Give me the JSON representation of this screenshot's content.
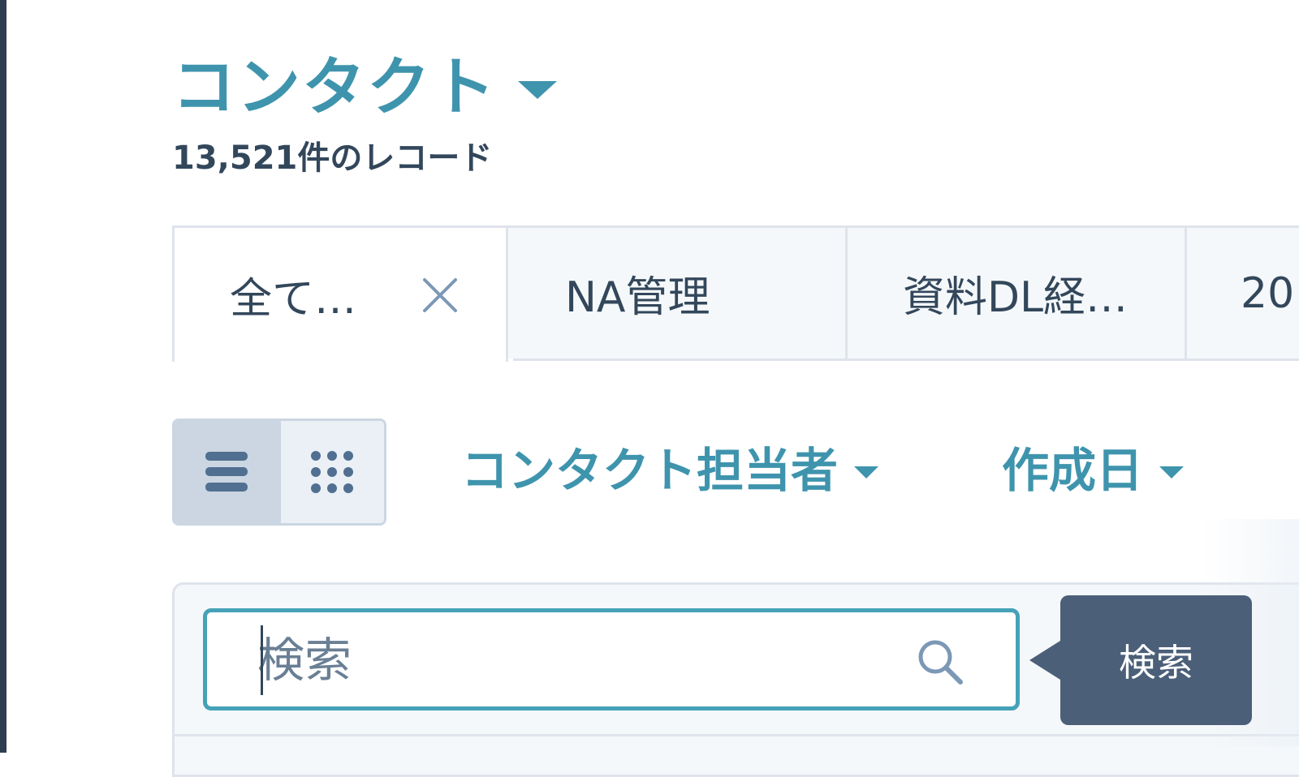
{
  "header": {
    "title": "コンタクト",
    "record_count": "13,521件のレコード"
  },
  "tabs": [
    {
      "label": "全て…",
      "active": true,
      "closable": true
    },
    {
      "label": "NA管理",
      "active": false
    },
    {
      "label": "資料DL経…",
      "active": false
    },
    {
      "label": "20",
      "active": false
    }
  ],
  "toolbar": {
    "view_modes": [
      "list-view-icon",
      "grid-view-icon"
    ],
    "active_view": "list",
    "filters": [
      {
        "label": "コンタクト担当者"
      },
      {
        "label": "作成日"
      }
    ]
  },
  "search": {
    "placeholder": "検索",
    "value": "",
    "tooltip": "検索"
  },
  "colors": {
    "accent": "#3f94ad",
    "focus_border": "#45a2b8",
    "tooltip_bg": "#4b5f79",
    "text": "#33475b"
  }
}
